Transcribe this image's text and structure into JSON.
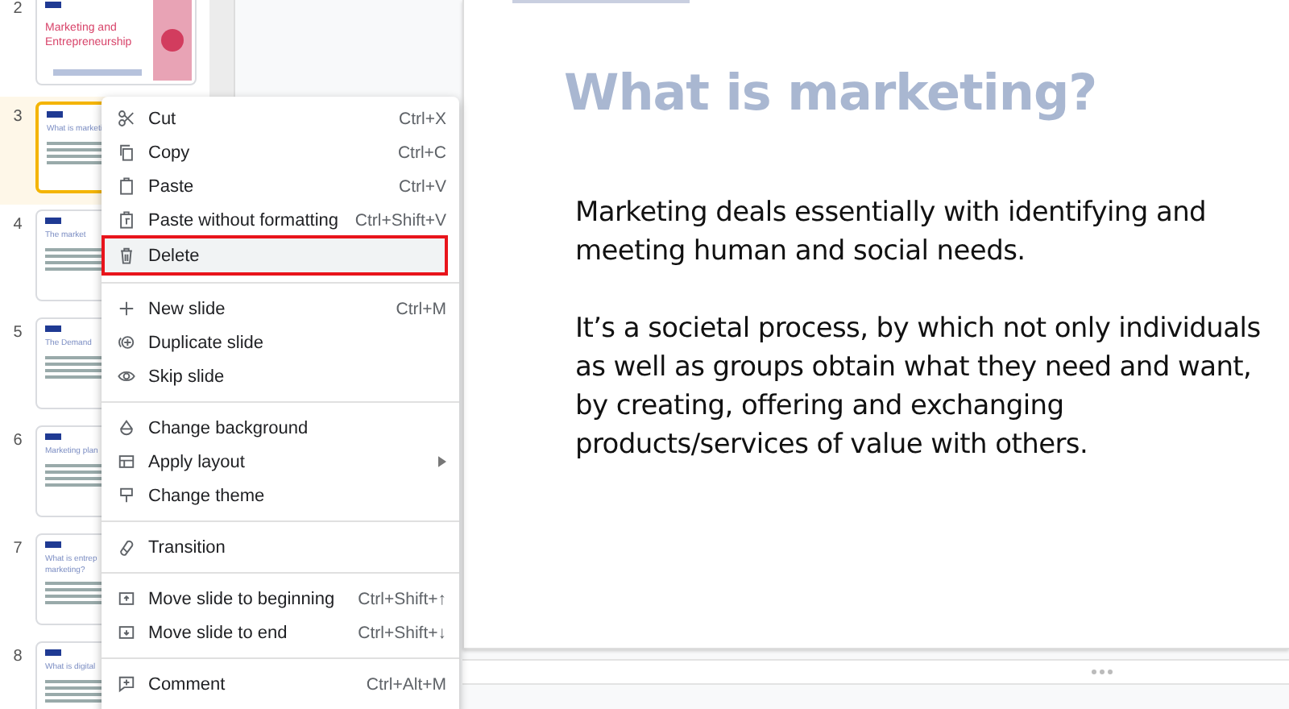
{
  "filmstrip": [
    {
      "number": "2",
      "title": "Marketing and Entrepreneurship",
      "kind": "cover",
      "selected": false
    },
    {
      "number": "3",
      "title": "What is marketi",
      "kind": "content",
      "selected": true
    },
    {
      "number": "4",
      "title": "The market",
      "kind": "content",
      "selected": false
    },
    {
      "number": "5",
      "title": "The Demand",
      "kind": "content",
      "selected": false
    },
    {
      "number": "6",
      "title": "Marketing plan",
      "kind": "content",
      "selected": false
    },
    {
      "number": "7",
      "title": "What is entrep marketing?",
      "kind": "content",
      "selected": false
    },
    {
      "number": "8",
      "title": "What is digital",
      "kind": "content",
      "selected": false
    }
  ],
  "slide": {
    "title": "What is marketing?",
    "paragraphs": [
      "Marketing deals essentially with identifying and meeting human and social needs.",
      "It’s a societal process, by which not only individuals as well as groups obtain what they need and want, by creating, offering and exchanging products/services of value with others."
    ]
  },
  "context_menu": {
    "groups": [
      [
        {
          "label": "Cut",
          "shortcut": "Ctrl+X",
          "highlighted": false,
          "submenu": false
        },
        {
          "label": "Copy",
          "shortcut": "Ctrl+C",
          "highlighted": false,
          "submenu": false
        },
        {
          "label": "Paste",
          "shortcut": "Ctrl+V",
          "highlighted": false,
          "submenu": false
        },
        {
          "label": "Paste without formatting",
          "shortcut": "Ctrl+Shift+V",
          "highlighted": false,
          "submenu": false
        },
        {
          "label": "Delete",
          "highlighted": true,
          "submenu": false
        }
      ],
      [
        {
          "label": "New slide",
          "shortcut": "Ctrl+M",
          "highlighted": false,
          "submenu": false
        },
        {
          "label": "Duplicate slide",
          "highlighted": false,
          "submenu": false
        },
        {
          "label": "Skip slide",
          "highlighted": false,
          "submenu": false
        }
      ],
      [
        {
          "label": "Change background",
          "highlighted": false,
          "submenu": false
        },
        {
          "label": "Apply layout",
          "highlighted": false,
          "submenu": true
        },
        {
          "label": "Change theme",
          "highlighted": false,
          "submenu": false
        }
      ],
      [
        {
          "label": "Transition",
          "highlighted": false,
          "submenu": false
        }
      ],
      [
        {
          "label": "Move slide to beginning",
          "shortcut": "Ctrl+Shift+↑",
          "highlighted": false,
          "submenu": false
        },
        {
          "label": "Move slide to end",
          "shortcut": "Ctrl+Shift+↓",
          "highlighted": false,
          "submenu": false
        }
      ],
      [
        {
          "label": "Comment",
          "shortcut": "Ctrl+Alt+M",
          "highlighted": false,
          "submenu": false
        }
      ]
    ]
  }
}
